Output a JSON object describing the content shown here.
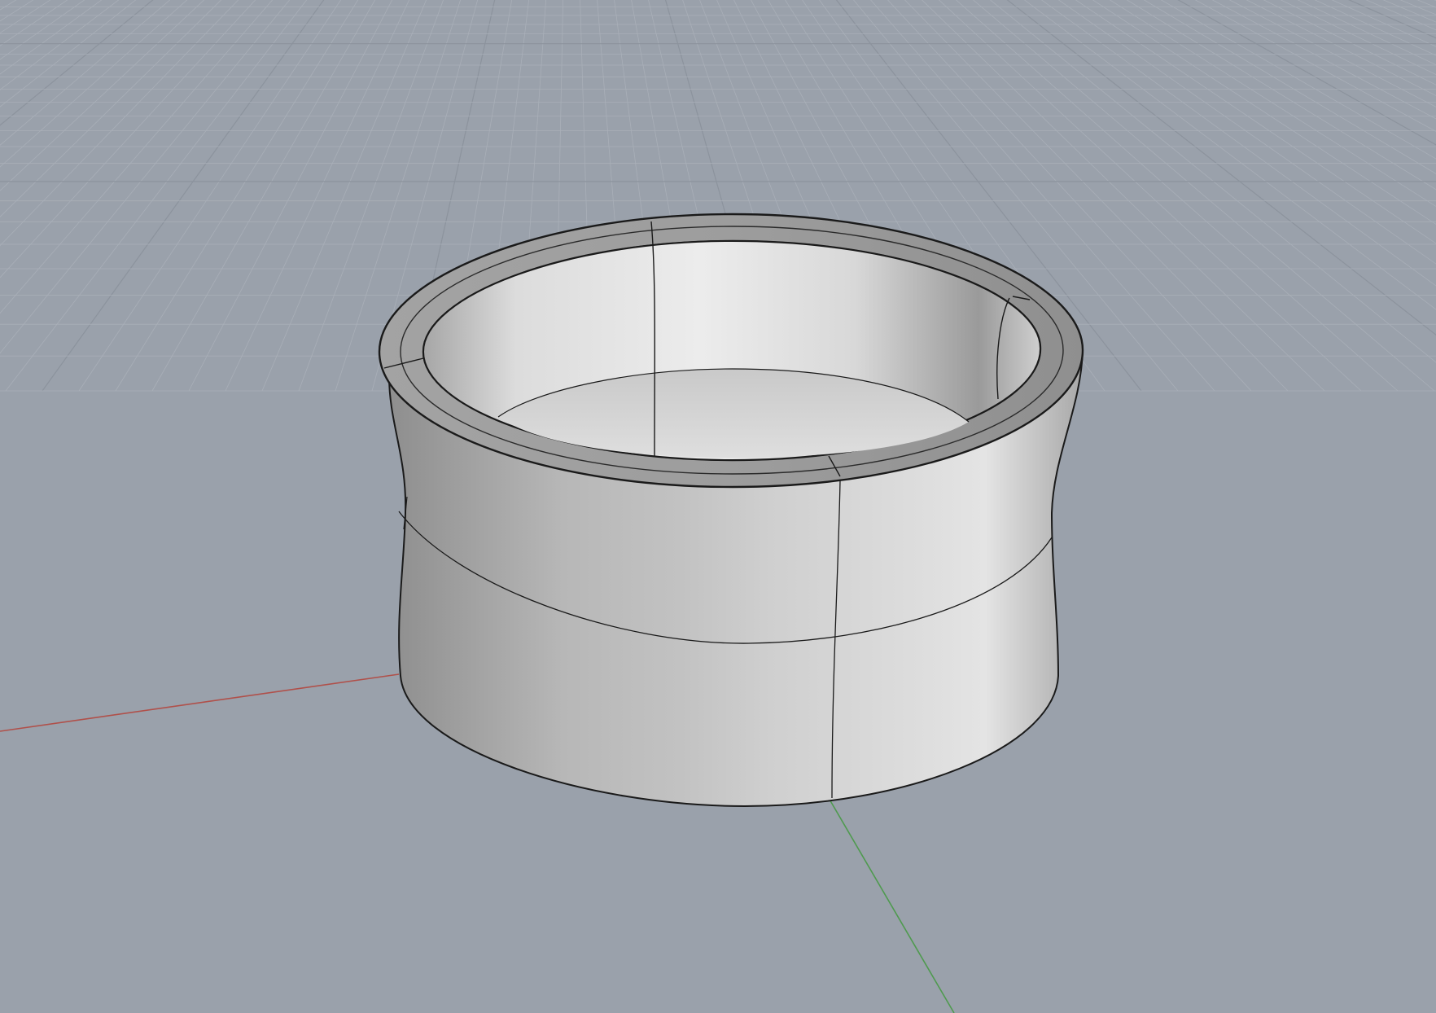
{
  "viewport": {
    "background_color": "#9aa1ab",
    "grid_minor_color": "#a9afb8",
    "grid_major_color": "#8c939d",
    "x_axis_color": "#b0504a",
    "y_axis_color": "#4f9a4f",
    "model_edge_color": "#1a1a1a"
  },
  "model": {
    "shape": "ring",
    "icon": "ring-model-icon"
  }
}
